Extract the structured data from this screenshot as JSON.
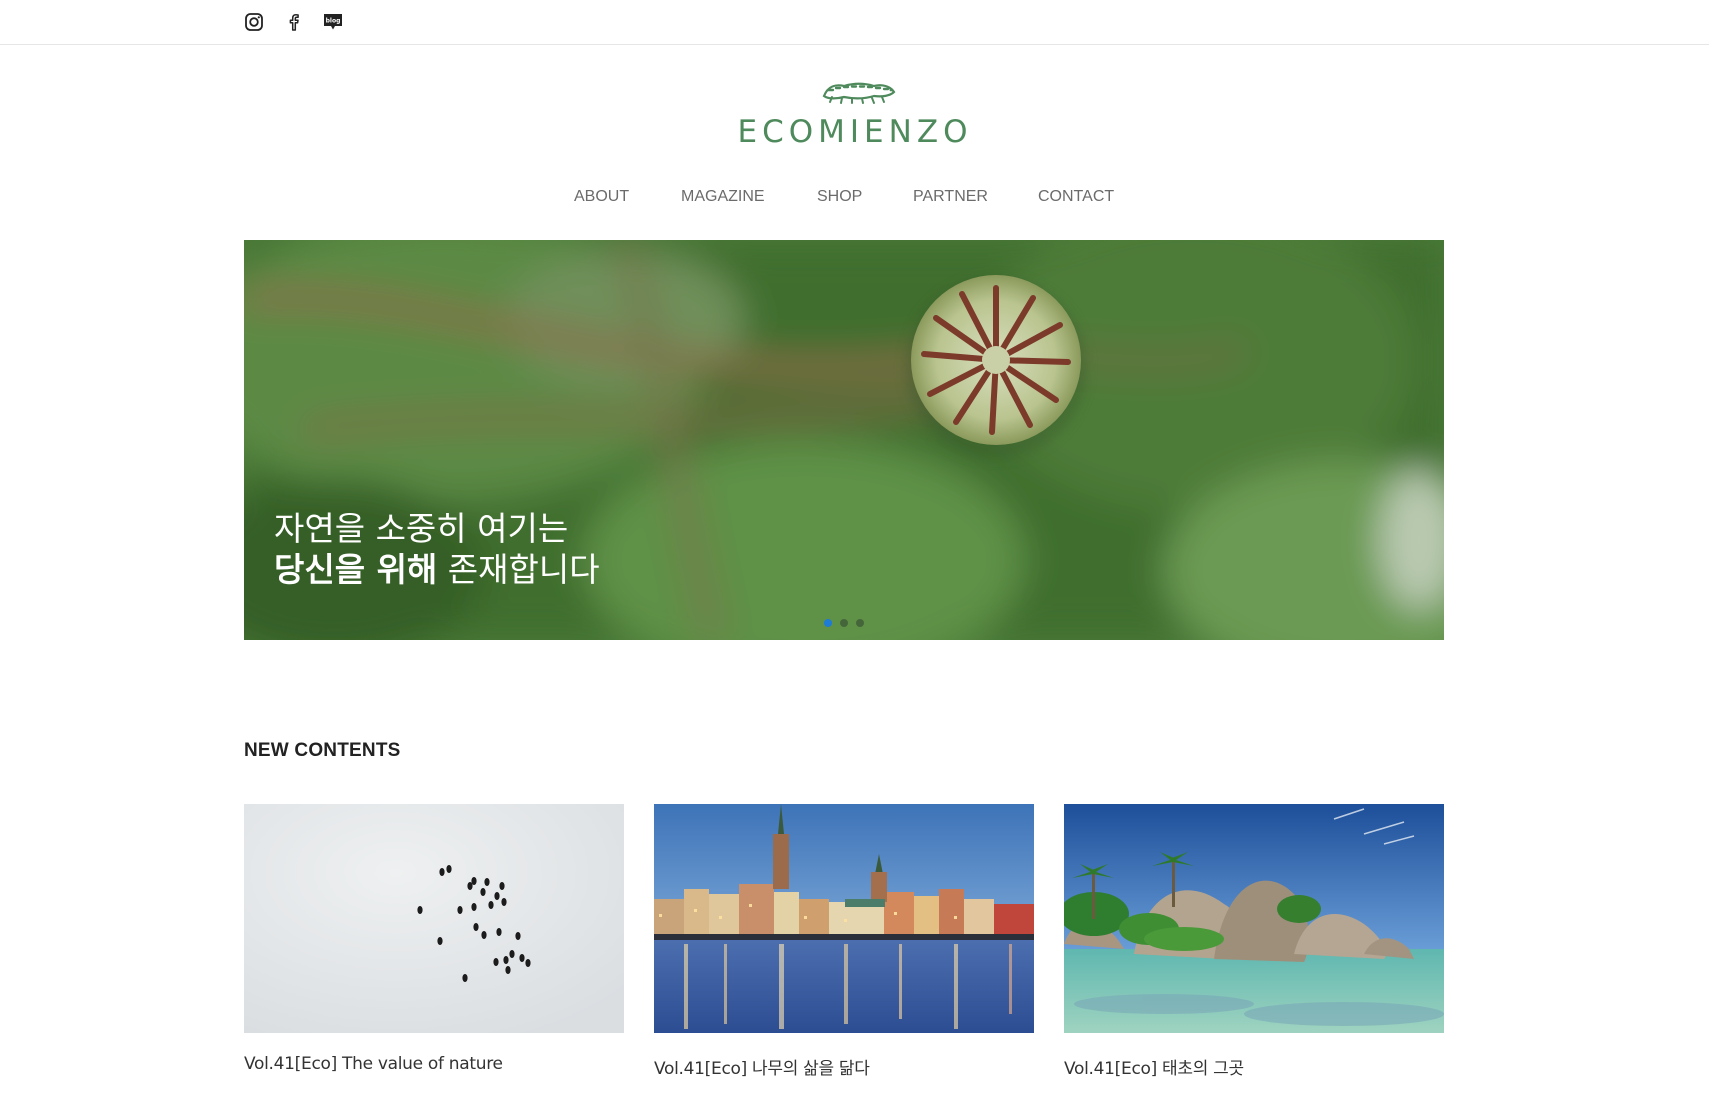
{
  "social": {
    "instagram": "instagram-icon",
    "facebook": "facebook-icon",
    "blog": "blog",
    "blog_icon": "blog-icon"
  },
  "logo": {
    "text": "ECOMIENZO",
    "icon": "caterpillar-logo",
    "color": "#4e8a5c"
  },
  "nav": {
    "items": [
      {
        "label": "ABOUT"
      },
      {
        "label": "MAGAZINE"
      },
      {
        "label": "SHOP"
      },
      {
        "label": "PARTNER"
      },
      {
        "label": "CONTACT"
      }
    ]
  },
  "hero": {
    "line1": "자연을 소중히 여기는",
    "line2_bold": "당신을 위해",
    "line2_rest": " 존재합니다",
    "active_slide": 1,
    "slide_count": 3,
    "dot_active_color": "#1e7bd6"
  },
  "section": {
    "title": "NEW CONTENTS"
  },
  "cards": [
    {
      "caption": "Vol.41[Eco] The value of nature",
      "image": "penguins-on-snow"
    },
    {
      "caption": "Vol.41[Eco] 나무의 삶을 닮다",
      "image": "city-waterfront-dusk"
    },
    {
      "caption": "Vol.41[Eco] 태초의 그곳",
      "image": "tropical-rocky-beach"
    }
  ]
}
